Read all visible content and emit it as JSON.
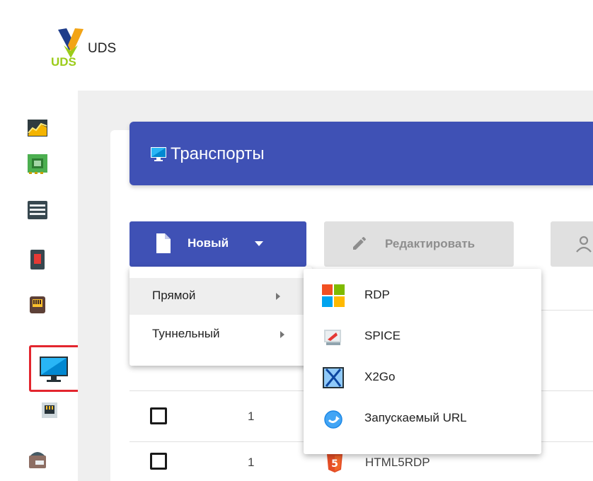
{
  "app": {
    "logo_text": "UDS",
    "title": "UDS"
  },
  "sidebar": {
    "items": [
      {
        "icon": "dashboard-icon"
      },
      {
        "icon": "services-icon"
      },
      {
        "icon": "authenticators-icon"
      },
      {
        "icon": "os-managers-icon"
      },
      {
        "icon": "networks-icon"
      },
      {
        "icon": "transports-icon",
        "active": true
      },
      {
        "icon": "tunnels-icon"
      },
      {
        "icon": "pools-icon"
      }
    ],
    "highlight_color": "#e3262e"
  },
  "page": {
    "title": "Транспорты",
    "header_color": "#3f51b5"
  },
  "toolbar": {
    "new_label": "Новый",
    "edit_label": "Редактировать"
  },
  "table": {
    "rows": [
      {
        "num": "1",
        "name": ""
      },
      {
        "num": "1",
        "name": "HTML5RDP"
      }
    ]
  },
  "new_menu": {
    "items": [
      {
        "label": "Прямой",
        "has_submenu": true
      },
      {
        "label": "Туннельный",
        "has_submenu": true
      }
    ]
  },
  "submenu": {
    "items": [
      {
        "label": "RDP",
        "icon": "windows-icon"
      },
      {
        "label": "SPICE",
        "icon": "spice-icon"
      },
      {
        "label": "X2Go",
        "icon": "x2go-icon"
      },
      {
        "label": "Запускаемый URL",
        "icon": "url-launcher-icon"
      }
    ]
  }
}
